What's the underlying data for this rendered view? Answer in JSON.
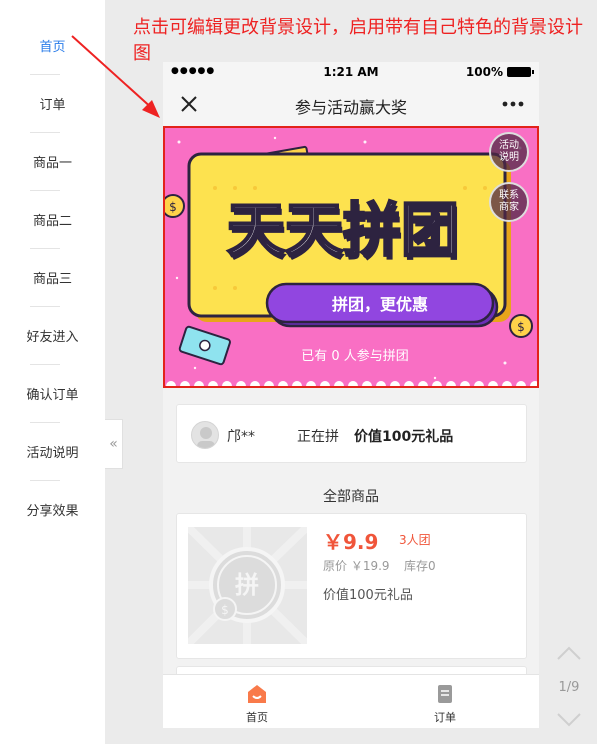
{
  "sidebar": {
    "items": [
      {
        "label": "首页"
      },
      {
        "label": "订单"
      },
      {
        "label": "商品一"
      },
      {
        "label": "商品二"
      },
      {
        "label": "商品三"
      },
      {
        "label": "好友进入"
      },
      {
        "label": "确认订单"
      },
      {
        "label": "活动说明"
      },
      {
        "label": "分享效果"
      }
    ],
    "collapse_icon": "«"
  },
  "annotation": "点击可编辑更改背景设计，启用带有自己特色的背景设计图",
  "phone": {
    "status": {
      "signal": "●●●●●",
      "time": "1:21 AM",
      "battery": "100%"
    },
    "nav_title": "参与活动赢大奖",
    "banner": {
      "headline": "天天拼团",
      "ribbon": "拼团，更优惠",
      "participants": "已有 0 人参与拼团",
      "btn_rules": "活动说明",
      "btn_contact": "联系商家"
    },
    "current_group": {
      "name": "邝**",
      "status": "正在拼",
      "product": "价值100元礼品"
    },
    "section_title": "全部商品",
    "product": {
      "price": "￥9.9",
      "group_size": "3人团",
      "original_price": "原价 ￥19.9",
      "stock": "库存0",
      "name": "价值100元礼品",
      "placeholder_glyph": "拼"
    },
    "tabs": [
      {
        "label": "首页"
      },
      {
        "label": "订单"
      }
    ]
  },
  "pager": {
    "text": "1/9"
  },
  "colors": {
    "accent_blue": "#2b7de9",
    "annotation_red": "#ee2222",
    "price_orange": "#f0553a",
    "banner_pink": "#f96fc4",
    "banner_yellow": "#fde24f",
    "ribbon_purple": "#9146e0"
  }
}
